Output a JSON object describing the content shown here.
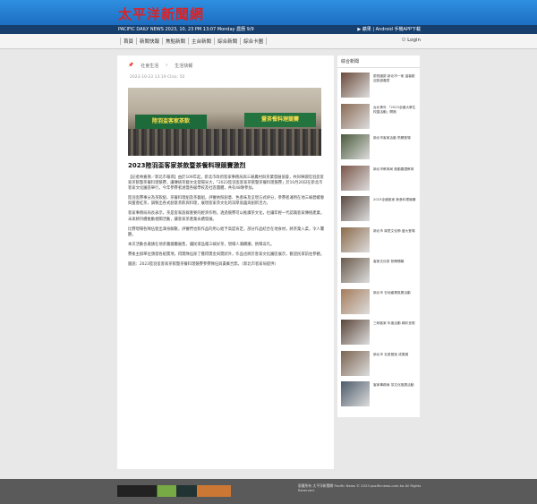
{
  "header": {
    "logo": "太平洋新聞網"
  },
  "infobar": {
    "date": "PACIFIC DAILY NEWS 2023, 10, 23 PM 13:07 Monday  農曆 9/9",
    "apps": "▶ 蘋果 | Android 手機APP下載"
  },
  "nav": {
    "items": [
      "首頁",
      "新聞快報",
      "焦點新聞",
      "主台新聞",
      "綜合新聞",
      "綜合卡圖"
    ],
    "login": "Login"
  },
  "article": {
    "breadcrumb": [
      "社會生活",
      "生活快報"
    ],
    "meta": "2023-10-23 13:19  Click: 50",
    "title": "2023陸羽盃客家茶飲暨茶餐料理競賽激烈",
    "paragraphs": [
      "【記者林嘉蒨／新北市報導】由於109年起，新北市政府客家事務局與三峽農村與茶業發展協會，共同舉辦陸羽盃客家茶飲暨茶餐料理競賽，讓傳統茶藝文化發揚光大，「2023陸羽盃客家茶飲暨茶餐料理競賽」於10月20日在新北市客家文化園區舉行，今年參賽者涵蓋各級學校及社區團體，共有48隊參加。",
      "陸羽盃賽事分為茶飲組、茶餐料理組及茶藝組，評審依照創意、色香味及呈現方式評分，參賽者運用在地三峽碧螺春與蜜香紅茶，調製出各式創意茶飲與料理，展現客家茶文化的深厚底蘊與創新活力。",
      "客家事務局局長表示，茶是客家族群重要的經濟作物，透過競賽可以推廣茶文化，也讓年輕一代認識客家傳統產業，未來將持續推動相關活動，讓客家茶產業永續發展。",
      "比賽現場各隊伍使出渾身解數，評審們也對作品的用心給予高度肯定，部分作品結合在地食材，將茶葉入菜，令人驚艷。",
      "本次活動也邀請在地茶農擺攤展售，讓民眾品嚐三峽好茶，現場人潮踴躍，熱鬧非凡。",
      "賽後主辦單位頒發各組獎項，得獎隊伍除了獲得獎金與獎狀外，作品也將於客家文化園區展示，歡迎民眾前往參觀。",
      "圖說：2023陸羽盃客家茶飲暨茶餐料理競賽參賽隊伍與貴賓合影。（新北市客家局提供）"
    ]
  },
  "sidebar": {
    "title": "綜合新聞",
    "items": [
      "慶祝國慶 新北市一家 溫馨歡迎旅遊嘉賓",
      "台北青年 「2023全國大學生校園活動」開跑",
      "新北市客家活動 熱鬧登場",
      "新北市教育局 推動閱讀教育",
      "2023全國客家 美食料理競賽",
      "新北市 鄰里文化節 盛大登場",
      "客家文化祭 熱鬧開幕",
      "新北市 在地產業推廣活動",
      "三峽客家 年度活動 精彩呈現",
      "新北市 社區營造 成果展",
      "客家事務局 茶文化推廣活動"
    ],
    "colors": [
      "#6b4a3a",
      "#8a6b55",
      "#4a5a3a",
      "#7a5548",
      "#5b4a42",
      "#8b6a4a",
      "#6a5a4b",
      "#a47c5a",
      "#5a4538",
      "#7b6450",
      "#4b5a6a"
    ]
  },
  "footer": {
    "copy": "版權所有 太平洋新聞網 Pacific News © 2023 pacificnews.com.tw All Rights Reserved."
  }
}
